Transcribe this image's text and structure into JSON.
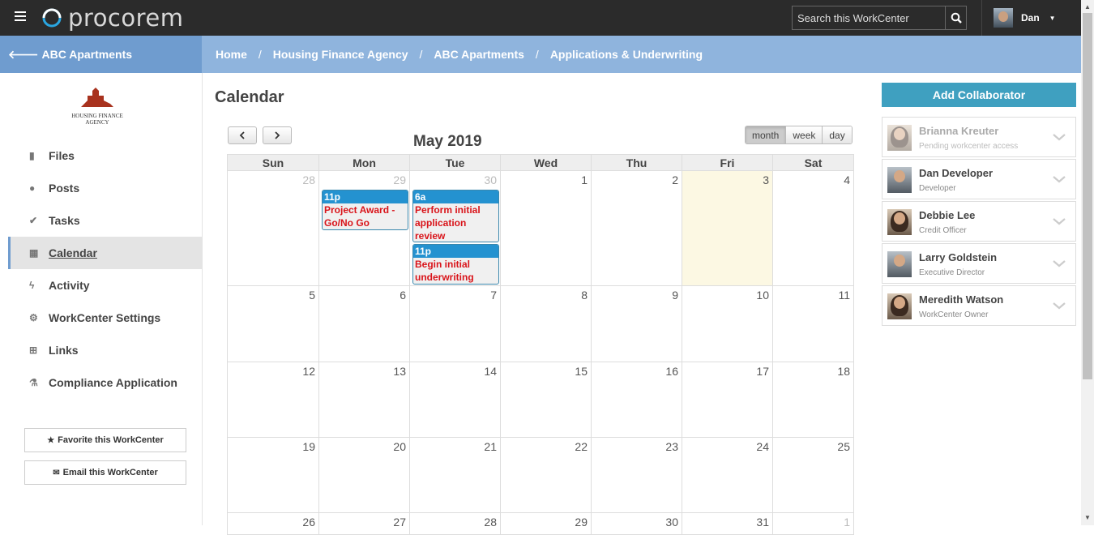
{
  "app": {
    "logo_text": "procorem",
    "search_placeholder": "Search this WorkCenter",
    "user_name": "Dan"
  },
  "subnav": {
    "back_label": "ABC Apartments",
    "breadcrumb": [
      "Home",
      "Housing Finance Agency",
      "ABC Apartments",
      "Applications & Underwriting"
    ]
  },
  "sidebar": {
    "org_name": "HOUSING FINANCE AGENCY",
    "items": [
      {
        "label": "Files",
        "icon": "file-icon"
      },
      {
        "label": "Posts",
        "icon": "comments-icon"
      },
      {
        "label": "Tasks",
        "icon": "check-icon"
      },
      {
        "label": "Calendar",
        "icon": "calendar-icon",
        "active": true
      },
      {
        "label": "Activity",
        "icon": "bolt-icon"
      },
      {
        "label": "WorkCenter Settings",
        "icon": "gear-icon"
      },
      {
        "label": "Links",
        "icon": "sitemap-icon"
      },
      {
        "label": "Compliance Application",
        "icon": "flask-icon"
      }
    ],
    "favorite_label": "Favorite this WorkCenter",
    "email_label": "Email this WorkCenter"
  },
  "main": {
    "title": "Calendar",
    "month_title": "May 2019",
    "views": [
      "month",
      "week",
      "day"
    ],
    "active_view": "month",
    "days_of_week": [
      "Sun",
      "Mon",
      "Tue",
      "Wed",
      "Thu",
      "Fri",
      "Sat"
    ],
    "weeks": [
      [
        "28",
        "29",
        "30",
        "1",
        "2",
        "3",
        "4"
      ],
      [
        "5",
        "6",
        "7",
        "8",
        "9",
        "10",
        "11"
      ],
      [
        "12",
        "13",
        "14",
        "15",
        "16",
        "17",
        "18"
      ],
      [
        "19",
        "20",
        "21",
        "22",
        "23",
        "24",
        "25"
      ],
      [
        "26",
        "27",
        "28",
        "29",
        "30",
        "31",
        "1"
      ]
    ],
    "events": [
      {
        "time": "11p",
        "title": "Project Award - Go/No Go"
      },
      {
        "time": "6a",
        "title": "Perform initial application review"
      },
      {
        "time": "11p",
        "title": "Begin initial underwriting"
      }
    ]
  },
  "collaborators": {
    "add_label": "Add Collaborator",
    "people": [
      {
        "name": "Brianna Kreuter",
        "role": "Pending workcenter access"
      },
      {
        "name": "Dan Developer",
        "role": "Developer"
      },
      {
        "name": "Debbie Lee",
        "role": "Credit Officer"
      },
      {
        "name": "Larry Goldstein",
        "role": "Executive Director"
      },
      {
        "name": "Meredith Watson",
        "role": "WorkCenter Owner"
      }
    ]
  },
  "colors": {
    "topbar": "#2b2b2b",
    "subbar": "#8fb4dd",
    "accent": "#3fa0c0",
    "event_header": "#2492d0",
    "event_text": "#d9141a",
    "today": "#fcf8e3"
  }
}
